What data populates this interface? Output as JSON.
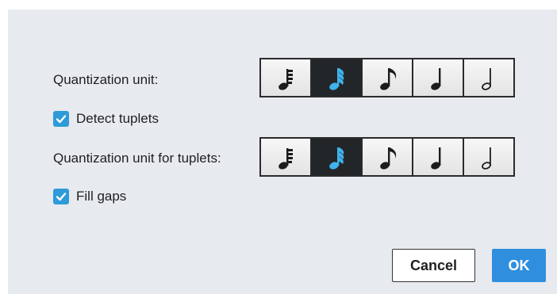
{
  "quantization": {
    "label": "Quantization unit:",
    "options": [
      {
        "icon": "sixty-fourth-note-icon",
        "selected": false
      },
      {
        "icon": "thirty-second-note-icon",
        "selected": true
      },
      {
        "icon": "eighth-note-icon",
        "selected": false
      },
      {
        "icon": "quarter-note-icon",
        "selected": false
      },
      {
        "icon": "half-note-icon",
        "selected": false
      }
    ]
  },
  "detect_tuplets": {
    "label": "Detect tuplets",
    "checked": true
  },
  "tuplet_quantization": {
    "label": "Quantization unit for tuplets:",
    "options": [
      {
        "icon": "sixty-fourth-note-icon",
        "selected": false
      },
      {
        "icon": "thirty-second-note-icon",
        "selected": true
      },
      {
        "icon": "eighth-note-icon",
        "selected": false
      },
      {
        "icon": "quarter-note-icon",
        "selected": false
      },
      {
        "icon": "half-note-icon",
        "selected": false
      }
    ]
  },
  "fill_gaps": {
    "label": "Fill gaps",
    "checked": true
  },
  "buttons": {
    "cancel": "Cancel",
    "ok": "OK"
  },
  "colors": {
    "accent": "#2f8fde",
    "checkbox": "#2e9bd8",
    "selected_bg": "#222629",
    "selected_note": "#3fb3ee",
    "note": "#1c1c1c"
  }
}
